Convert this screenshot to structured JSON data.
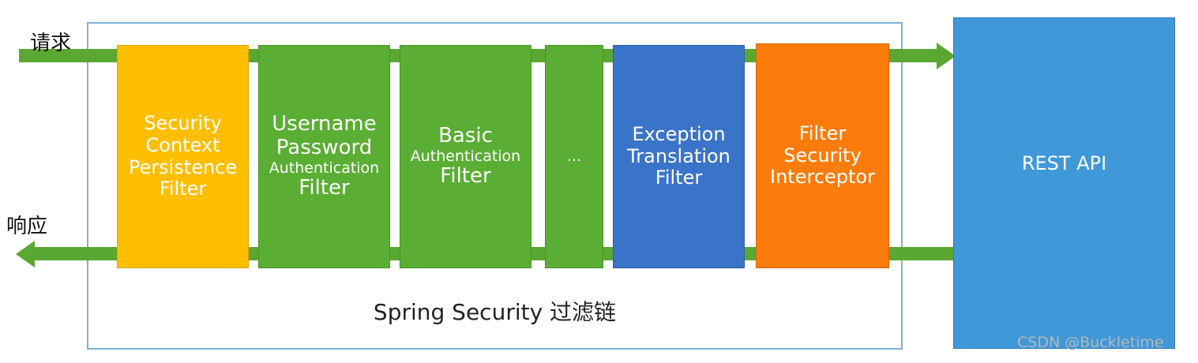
{
  "labels": {
    "request": "请求",
    "response": "响应",
    "chain_caption": "Spring Security 过滤链",
    "rest_api": "REST API",
    "watermark": "CSDN @Buckletime"
  },
  "filters": [
    {
      "lines": [
        "Security",
        "Context",
        "Persistence",
        "Filter"
      ]
    },
    {
      "lines": [
        "Username",
        "Password",
        "Authentication",
        "Filter"
      ]
    },
    {
      "lines": [
        "Basic",
        "Authentication",
        "Filter"
      ]
    },
    {
      "lines": [
        "..."
      ]
    },
    {
      "lines": [
        "Exception",
        "Translation",
        "Filter"
      ]
    },
    {
      "lines": [
        "Filter",
        "Security",
        "Interceptor"
      ]
    }
  ],
  "colors": {
    "flow_green": "#5aa832",
    "filter_yellow": "#ffbf00",
    "filter_green": "#5aae33",
    "filter_blue": "#3a74c8",
    "filter_orange": "#fb7c0a",
    "rest_blue": "#3f98d8",
    "frame_border": "#7fb0dc"
  }
}
